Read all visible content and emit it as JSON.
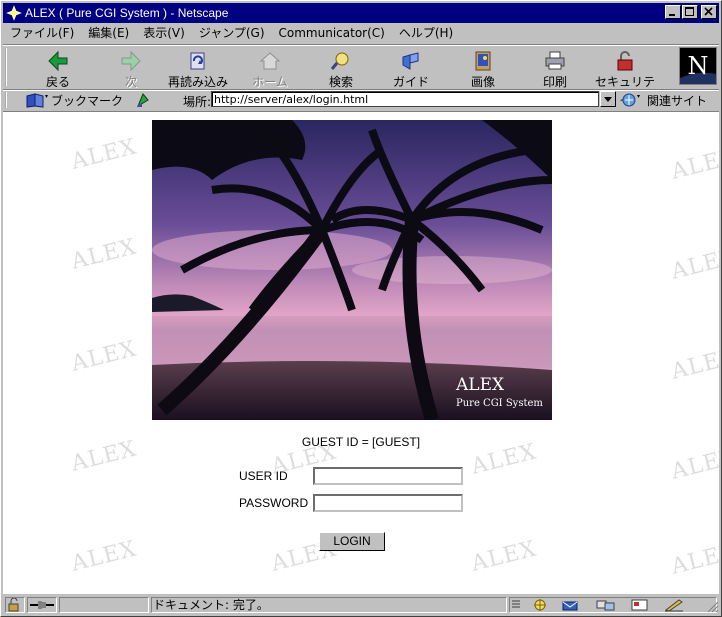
{
  "window": {
    "title": "ALEX ( Pure CGI System ) - Netscape"
  },
  "menu": [
    {
      "label": "ファイル(F)"
    },
    {
      "label": "編集(E)"
    },
    {
      "label": "表示(V)"
    },
    {
      "label": "ジャンプ(G)"
    },
    {
      "label": "Communicator(C)"
    },
    {
      "label": "ヘルプ(H)"
    }
  ],
  "toolbar": {
    "back": "戻る",
    "forward": "次",
    "reload": "再読み込み",
    "home": "ホーム",
    "search": "検索",
    "guide": "ガイド",
    "images": "画像",
    "print": "印刷",
    "security": "セキュリティ"
  },
  "location": {
    "bookmarks": "ブックマーク",
    "label": "場所:",
    "url": "http://server/alex/login.html",
    "related": "関連サイト"
  },
  "page": {
    "watermark": "ALEX",
    "photo_title": "ALEX",
    "photo_subtitle": "Pure CGI System",
    "guest_id": "GUEST ID = [GUEST]",
    "user_id_label": "USER ID",
    "password_label": "PASSWORD",
    "user_id_value": "",
    "password_value": "",
    "login_button": "LOGIN"
  },
  "status": {
    "text": "ドキュメント: 完了。"
  },
  "colors": {
    "titlebar": "#000080",
    "chrome": "#c0c0c0"
  }
}
